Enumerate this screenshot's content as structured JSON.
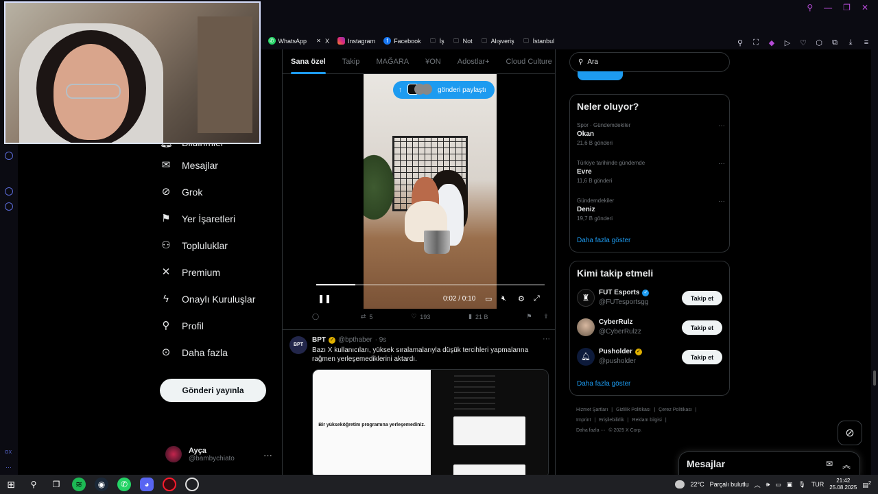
{
  "bookmarks": [
    {
      "label": "v",
      "icon": "partial-icon"
    },
    {
      "label": "WhatsApp",
      "icon": "whatsapp-icon"
    },
    {
      "label": "X",
      "icon": "x-icon"
    },
    {
      "label": "Instagram",
      "icon": "instagram-icon"
    },
    {
      "label": "Facebook",
      "icon": "facebook-icon"
    },
    {
      "label": "İş",
      "icon": "folder-icon"
    },
    {
      "label": "Not",
      "icon": "folder-icon"
    },
    {
      "label": "Alışveriş",
      "icon": "folder-icon"
    },
    {
      "label": "İstanbul",
      "icon": "folder-icon"
    }
  ],
  "sidebar": {
    "partial_item": "Bildirimler",
    "items": [
      {
        "label": "Mesajlar",
        "icon": "mail-icon"
      },
      {
        "label": "Grok",
        "icon": "grok-icon"
      },
      {
        "label": "Yer İşaretleri",
        "icon": "bookmark-icon"
      },
      {
        "label": "Topluluklar",
        "icon": "communities-icon"
      },
      {
        "label": "Premium",
        "icon": "x-logo-icon"
      },
      {
        "label": "Onaylı Kuruluşlar",
        "icon": "lightning-icon"
      },
      {
        "label": "Profil",
        "icon": "person-icon"
      },
      {
        "label": "Daha fazla",
        "icon": "more-circle-icon"
      }
    ],
    "post_button": "Gönderi yayınla",
    "profile": {
      "name": "Ayça",
      "handle": "@bambychiato"
    }
  },
  "tabs": [
    "Sana özel",
    "Takip",
    "MAĞARA",
    "¥ON",
    "Adostlar+",
    "Cloud Culture"
  ],
  "video": {
    "shared_label": "gönderi paylaştı",
    "time": "0:02 / 0:10",
    "progress": 0.17
  },
  "tweet1_actions": {
    "replies": "",
    "reposts": "5",
    "likes": "193",
    "views": "21 B"
  },
  "tweet2": {
    "avatar_text": "BPT",
    "name": "BPT",
    "handle": "@bpthaber",
    "time": "· 9s",
    "text": "Bazı X kullanıcıları, yüksek sıralamalarıyla düşük tercihleri yapmalarına rağmen yerleşemediklerini aktardı.",
    "media_text": "Bir yükseköğretim programına yerleşemediniz."
  },
  "search": {
    "placeholder": "Ara"
  },
  "trends": {
    "title": "Neler oluyor?",
    "items": [
      {
        "context": "Spor · Gündemdekiler",
        "title": "Okan",
        "count": "21,6 B gönderi"
      },
      {
        "context": "Türkiye tarihinde gündemde",
        "title": "Evre",
        "count": "11,6 B gönderi"
      },
      {
        "context": "Gündemdekiler",
        "title": "Deniz",
        "count": "19,7 B gönderi"
      }
    ],
    "show_more": "Daha fazla göster"
  },
  "who_to_follow": {
    "title": "Kimi takip etmeli",
    "items": [
      {
        "name": "FUT Esports",
        "handle": "@FUTesportsgg",
        "badge": "blue",
        "avatar_color": "#0a0a0a"
      },
      {
        "name": "CyberRulz",
        "handle": "@CyberRulzz",
        "badge": "none",
        "avatar_color": "#8a7a6a"
      },
      {
        "name": "Pusholder",
        "handle": "@pusholder",
        "badge": "gold",
        "avatar_color": "#0d1a3a"
      }
    ],
    "follow_label": "Takip et",
    "show_more": "Daha fazla göster"
  },
  "footer": {
    "line1": [
      "Hizmet Şartları",
      "|",
      "Gizlilik Politikası",
      "|",
      "Çerez Politikası",
      "|"
    ],
    "line2": [
      "Imprint",
      "|",
      "Erişilebilirlik",
      "|",
      "Reklam bilgisi",
      "|"
    ],
    "line3": [
      "Daha fazla ···",
      "© 2025 X Corp."
    ]
  },
  "dm_dock": {
    "title": "Mesajlar"
  },
  "taskbar": {
    "weather_temp": "22°C",
    "weather_text": "Parçalı bulutlu",
    "lang": "TUR",
    "time": "21:42",
    "date": "25.08.2025",
    "notif_count": "2"
  },
  "colors": {
    "accent": "#1d9bf0",
    "bg": "#000000",
    "border": "#2f3336"
  }
}
